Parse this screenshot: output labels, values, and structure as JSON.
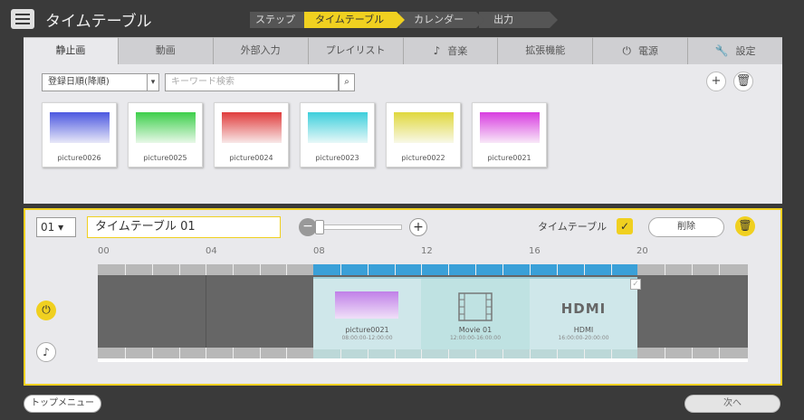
{
  "header": {
    "title": "タイムテーブル",
    "steps_label": "ステップ",
    "steps": [
      "タイムテーブル",
      "カレンダー",
      "出力"
    ],
    "active_step": 0
  },
  "tabs": [
    {
      "label": "静止画",
      "icon": "",
      "active": true
    },
    {
      "label": "動画",
      "icon": "",
      "active": false
    },
    {
      "label": "外部入力",
      "icon": "",
      "active": false
    },
    {
      "label": "プレイリスト",
      "icon": "",
      "active": false
    },
    {
      "label": "音楽",
      "icon": "music-note-icon",
      "active": false
    },
    {
      "label": "拡張機能",
      "icon": "",
      "active": false
    },
    {
      "label": "電源",
      "icon": "power-icon",
      "active": false
    },
    {
      "label": "設定",
      "icon": "wrench-icon",
      "active": false
    }
  ],
  "library": {
    "sort_value": "登録日順(降順)",
    "search_placeholder": "キーワード検索",
    "items": [
      {
        "name": "picture0026",
        "color": "blue"
      },
      {
        "name": "picture0025",
        "color": "green"
      },
      {
        "name": "picture0024",
        "color": "red"
      },
      {
        "name": "picture0023",
        "color": "cyan"
      },
      {
        "name": "picture0022",
        "color": "yellow"
      },
      {
        "name": "picture0021",
        "color": "magenta"
      }
    ]
  },
  "timetable": {
    "number": "01",
    "name": "タイムテーブル 01",
    "toggle_label": "タイムテーブル",
    "delete_label": "削除",
    "hours": [
      "00",
      "04",
      "08",
      "12",
      "16",
      "20"
    ],
    "blocks": [
      {
        "name": "picture0021",
        "time": "08:00:00-12:00:00",
        "kind": "image"
      },
      {
        "name": "Movie 01",
        "time": "12:00:00-16:00:00",
        "kind": "movie"
      },
      {
        "name": "HDMI",
        "time": "16:00:00-20:00:00",
        "kind": "hdmi",
        "label": "HDMI"
      }
    ]
  },
  "footer": {
    "top_menu": "トップメニュー",
    "next": "次へ"
  },
  "colors": {
    "accent": "#f0d020",
    "background": "#3a3a3a",
    "panel": "#e9e9ec",
    "timeline_bar": "#3aa0d8"
  }
}
